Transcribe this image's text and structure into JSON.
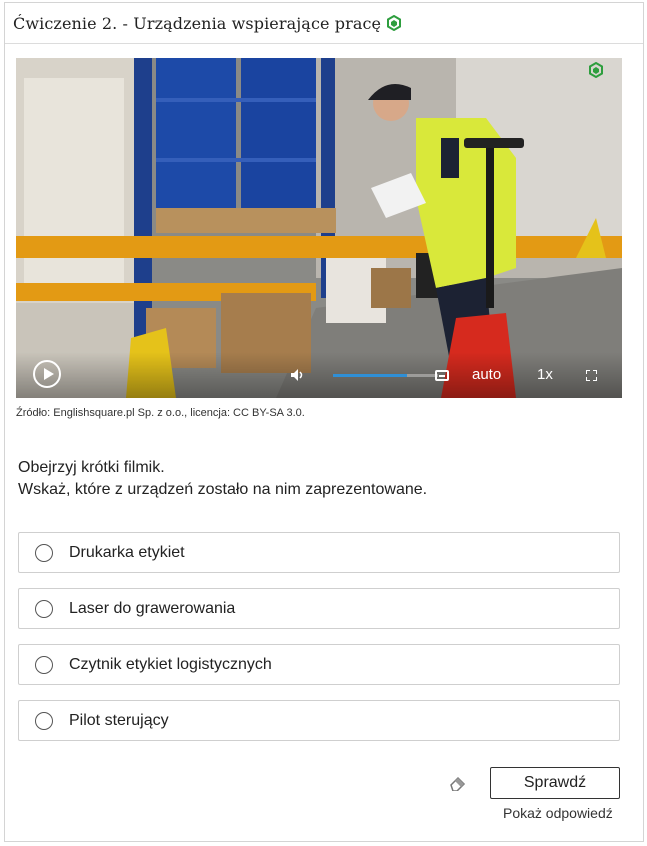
{
  "exercise": {
    "title": "Ćwiczenie 2. - Urządzenia wspierające pracę",
    "title_icon": "hexagon-badge-icon",
    "accent_color": "#2e9e3e"
  },
  "video": {
    "quality": "auto",
    "speed": "1x",
    "progress_fraction": 0.7,
    "icons": [
      "play-icon",
      "volume-icon",
      "captions-icon",
      "fullscreen-icon",
      "hexagon-badge-icon"
    ]
  },
  "source_caption": "Źródło: Englishsquare.pl Sp. z o.o., licencja: CC BY-SA 3.0.",
  "instructions": {
    "line1": "Obejrzyj krótki filmik.",
    "line2": "Wskaż, które z urządzeń zostało na nim zaprezentowane."
  },
  "options": [
    {
      "label": "Drukarka etykiet"
    },
    {
      "label": "Laser do grawerowania"
    },
    {
      "label": "Czytnik etykiet logistycznych"
    },
    {
      "label": "Pilot sterujący"
    }
  ],
  "actions": {
    "check_label": "Sprawdź",
    "show_answer_label": "Pokaż odpowiedź",
    "eraser_icon": "eraser-icon"
  }
}
